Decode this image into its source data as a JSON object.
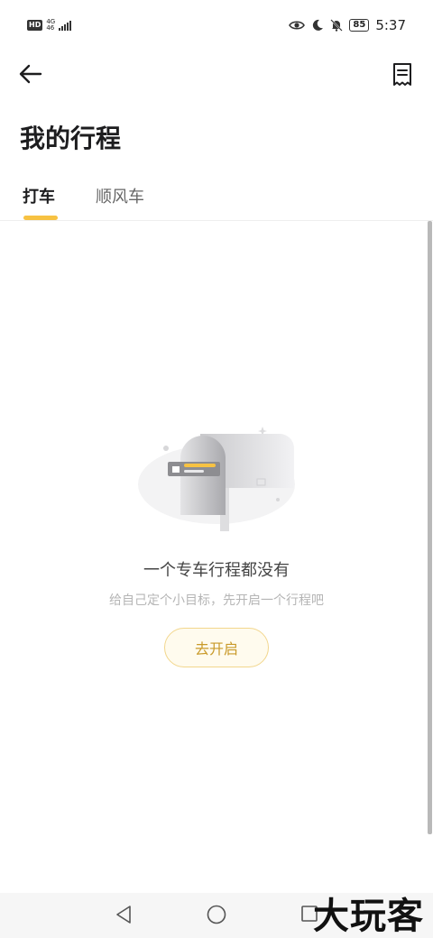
{
  "status_bar": {
    "hd": "HD",
    "network_top": "4G",
    "network_bottom": "46",
    "battery": "85",
    "time": "5:37"
  },
  "header": {
    "back_icon": "arrow-left-icon",
    "receipt_icon": "receipt-icon"
  },
  "page": {
    "title": "我的行程"
  },
  "tabs": [
    {
      "label": "打车",
      "active": true
    },
    {
      "label": "顺风车",
      "active": false
    }
  ],
  "empty_state": {
    "title": "一个专车行程都没有",
    "subtitle": "给自己定个小目标，先开启一个行程吧",
    "button_label": "去开启"
  },
  "colors": {
    "accent": "#f7c242",
    "button_text": "#c99a2a"
  },
  "watermark": "大玩客"
}
